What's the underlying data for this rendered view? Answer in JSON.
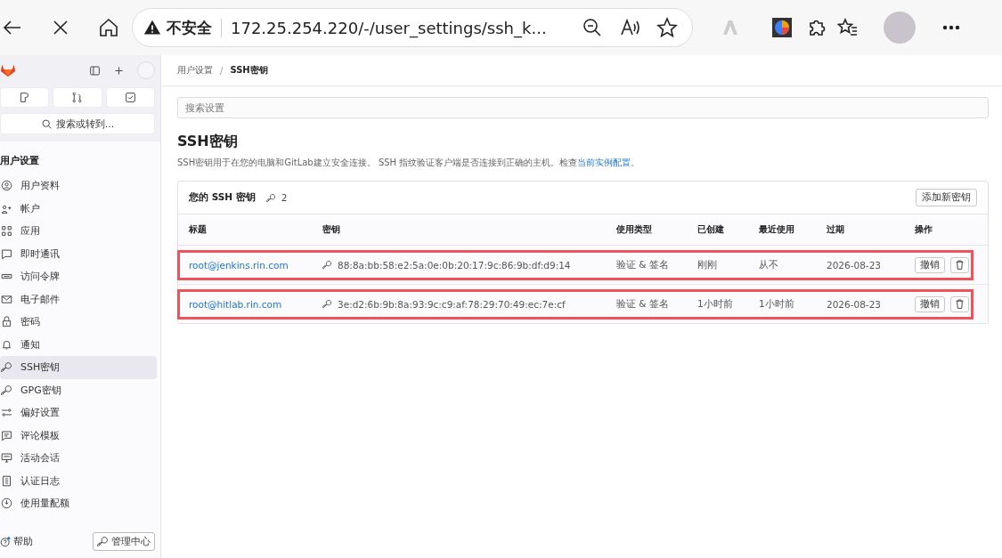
{
  "browser": {
    "security": "不安全",
    "url": "172.25.254.220/-/user_settings/ssh_k..."
  },
  "sidebar": {
    "search": "搜索或转到...",
    "section_title": "用户设置",
    "items": [
      {
        "label": "用户资料",
        "selected": false
      },
      {
        "label": "帐户",
        "selected": false
      },
      {
        "label": "应用",
        "selected": false
      },
      {
        "label": "即时通讯",
        "selected": false
      },
      {
        "label": "访问令牌",
        "selected": false
      },
      {
        "label": "电子邮件",
        "selected": false
      },
      {
        "label": "密码",
        "selected": false
      },
      {
        "label": "通知",
        "selected": false
      },
      {
        "label": "SSH密钥",
        "selected": true
      },
      {
        "label": "GPG密钥",
        "selected": false
      },
      {
        "label": "偏好设置",
        "selected": false
      },
      {
        "label": "评论模板",
        "selected": false
      },
      {
        "label": "活动会话",
        "selected": false
      },
      {
        "label": "认证日志",
        "selected": false
      },
      {
        "label": "使用量配额",
        "selected": false
      }
    ],
    "help": "帮助",
    "admin": "管理中心"
  },
  "breadcrumb": [
    "用户设置",
    "SSH密钥"
  ],
  "breadcrumb_separator": "/",
  "search": {
    "placeholder": "搜索设置"
  },
  "title": "SSH密钥",
  "description": {
    "text": "SSH密钥用于在您的电脑和GitLab建立安全连接。 SSH 指纹验证客户端是否连接到正确的主机。检查",
    "link": "当前实例配置",
    "end": "。"
  },
  "card": {
    "title": "您的 SSH 密钥",
    "count": "2",
    "add_button": "添加新密钥"
  },
  "table": {
    "columns": [
      "标题",
      "密钥",
      "使用类型",
      "已创建",
      "最近使用",
      "过期",
      "操作"
    ],
    "rows": [
      {
        "title": "root@jenkins.rin.com",
        "key": "88:8a:bb:58:e2:5a:0e:0b:20:17:9c:86:9b:df:d9:14",
        "usage": "验证 & 签名",
        "created": "刚刚",
        "last_used": "从不",
        "expires": "2026-08-23",
        "revoke": "撤销",
        "highlighted": true
      },
      {
        "title": "root@hitlab.rin.com",
        "key": "3e:d2:6b:9b:8a:93:9c:c9:af:78:29:70:49:ec:7e:cf",
        "usage": "验证 & 签名",
        "created": "1小时前",
        "last_used": "1小时前",
        "expires": "2026-08-23",
        "revoke": "撤销",
        "highlighted": true
      }
    ]
  }
}
